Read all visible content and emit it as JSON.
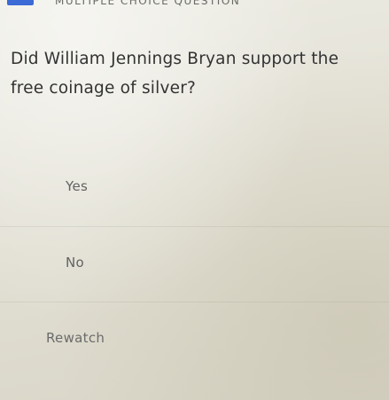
{
  "header": {
    "section_label": "MULTIPLE CHOICE QUESTION",
    "badge_color": "#3c6ad6"
  },
  "question": {
    "text": "Did William Jennings Bryan support the free coinage of silver?"
  },
  "options": [
    {
      "label": "Yes"
    },
    {
      "label": "No"
    }
  ],
  "actions": {
    "rewatch_label": "Rewatch"
  }
}
